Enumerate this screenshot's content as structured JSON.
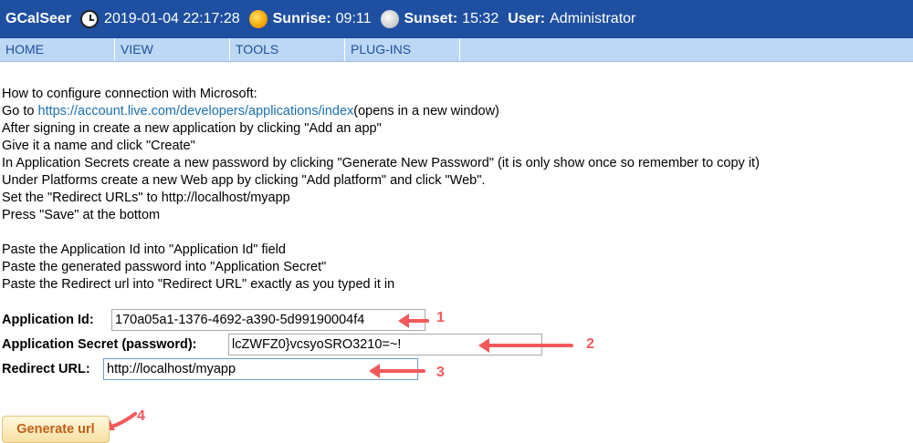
{
  "header": {
    "brand": "GCalSeer",
    "clock_icon": "clock-icon",
    "datetime": "2019-01-04 22:17:28",
    "sun_icon": "sun-icon",
    "sunrise_label": "Sunrise:",
    "sunrise_value": "09:11",
    "moon_icon": "moon-icon",
    "sunset_label": "Sunset:",
    "sunset_value": "15:32",
    "user_label": "User:",
    "user_value": "Administrator",
    "bg_color": "#1f4fa0"
  },
  "nav": {
    "items": [
      "HOME",
      "VIEW",
      "TOOLS",
      "PLUG-INS"
    ],
    "bg_color": "#bcd8f4"
  },
  "instructions": {
    "line1": "How to configure connection with Microsoft:",
    "line2_prefix": "Go to ",
    "line2_link": "https://account.live.com/developers/applications/index",
    "line2_suffix": "(opens in a new window)",
    "line3": "After signing in create a new application by clicking \"Add an app\"",
    "line4": "Give it a name and click \"Create\"",
    "line5": "In Application Secrets create a new password by clicking \"Generate New Password\" (it is only show once so remember to copy it)",
    "line6": "Under Platforms create a new Web app by clicking \"Add platform\" and click \"Web\".",
    "line7": "Set the \"Redirect URLs\" to http://localhost/myapp",
    "line8": "Press \"Save\" at the bottom",
    "line9": "Paste the Application Id into \"Application Id\" field",
    "line10": "Paste the generated password into \"Application Secret\"",
    "line11": "Paste the Redirect url into \"Redirect URL\" exactly as you typed it in"
  },
  "form": {
    "app_id_label": "Application Id:",
    "app_id_value": "170a05a1-1376-4692-a390-5d99190004f4",
    "app_secret_label": "Application Secret (password):",
    "app_secret_value": "lcZWFZ0}vcsyoSRO3210=~!",
    "redirect_label": "Redirect URL:",
    "redirect_value": "http://localhost/myapp",
    "generate_button": "Generate url"
  },
  "annotations": {
    "n1": "1",
    "n2": "2",
    "n3": "3",
    "n4": "4",
    "color": "#f25a5a"
  }
}
